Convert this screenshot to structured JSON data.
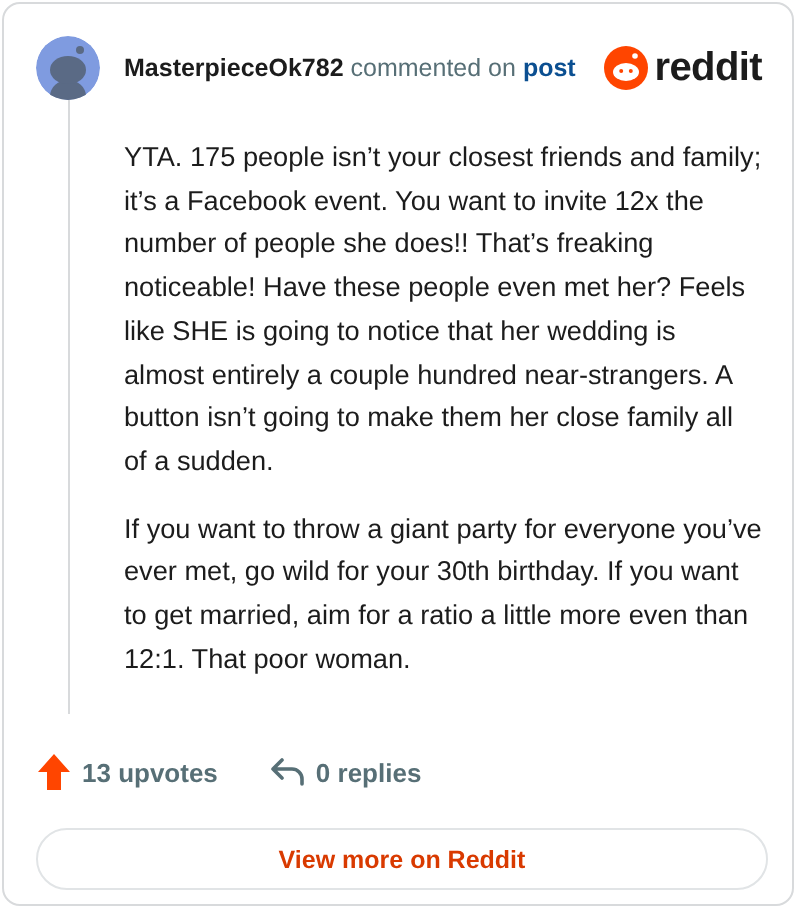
{
  "author": {
    "username": "MasterpieceOk782",
    "action": "commented on",
    "link": "post"
  },
  "brand": "reddit",
  "paragraphs": [
    "YTA. 175 people isn’t your closest friends and family; it’s a Facebook event. You want to invite 12x the number of people she does!! That’s freaking noticeable! Have these people even met her? Feels like SHE is going to notice that her wedding is almost entirely a couple hundred near-strangers. A button isn’t going to make them her close family all of a sudden.",
    "If you want to throw a giant party for everyone you’ve ever met, go wild for your 30th birthday. If you want to get married, aim for a ratio a little more even than 12:1. That poor woman."
  ],
  "stats": [
    {
      "kind": "upvotes",
      "label": "13 upvotes"
    },
    {
      "kind": "replies",
      "label": "0 replies"
    }
  ],
  "button": "View more on Reddit"
}
